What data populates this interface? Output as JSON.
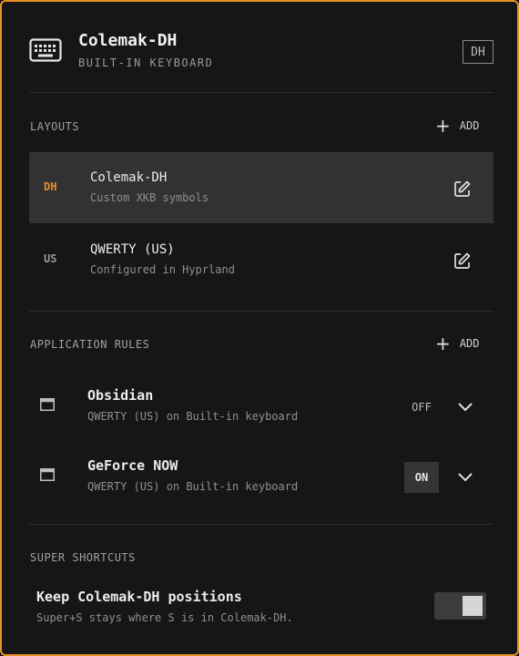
{
  "header": {
    "title": "Colemak-DH",
    "subtitle": "BUILT-IN KEYBOARD",
    "badge": "DH",
    "icon": "keyboard-icon"
  },
  "layouts": {
    "section_title": "LAYOUTS",
    "add_label": "ADD",
    "items": [
      {
        "code": "DH",
        "name": "Colemak-DH",
        "description": "Custom XKB symbols",
        "active": true
      },
      {
        "code": "US",
        "name": "QWERTY (US)",
        "description": "Configured in Hyprland",
        "active": false
      }
    ]
  },
  "rules": {
    "section_title": "APPLICATION RULES",
    "add_label": "ADD",
    "items": [
      {
        "name": "Obsidian",
        "description": "QWERTY (US) on Built-in keyboard",
        "state": "OFF"
      },
      {
        "name": "GeForce NOW",
        "description": "QWERTY (US) on Built-in keyboard",
        "state": "ON"
      }
    ]
  },
  "shortcuts": {
    "section_title": "SUPER SHORTCUTS",
    "title": "Keep Colemak-DH positions",
    "description": "Super+S stays where S is in Colemak-DH.",
    "enabled": true
  },
  "colors": {
    "accent": "#e8902a",
    "background": "#161616",
    "active_row": "#323232"
  }
}
